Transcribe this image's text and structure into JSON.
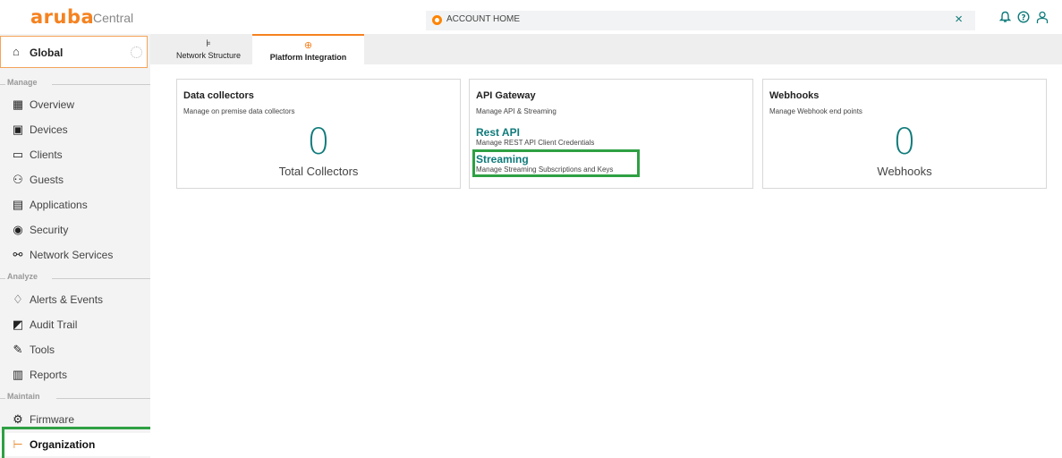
{
  "app": {
    "logo": "aruba",
    "product": "Central"
  },
  "search": {
    "text": "ACCOUNT HOME",
    "close": "×"
  },
  "header_icons": {
    "bell": "Δ",
    "help": "?",
    "user": "Ʌ"
  },
  "sidebar": {
    "global": {
      "label": "Global"
    },
    "sections": {
      "manage": "Manage",
      "analyze": "Analyze",
      "maintain": "Maintain"
    },
    "items": [
      {
        "label": "Overview",
        "icon": "▦"
      },
      {
        "label": "Devices",
        "icon": "▣"
      },
      {
        "label": "Clients",
        "icon": "▭"
      },
      {
        "label": "Guests",
        "icon": "⚇"
      },
      {
        "label": "Applications",
        "icon": "▤"
      },
      {
        "label": "Security",
        "icon": "◉"
      },
      {
        "label": "Network Services",
        "icon": "⚯"
      },
      {
        "label": "Alerts & Events",
        "icon": "♢"
      },
      {
        "label": "Audit Trail",
        "icon": "◩"
      },
      {
        "label": "Tools",
        "icon": "✎"
      },
      {
        "label": "Reports",
        "icon": "▥"
      },
      {
        "label": "Firmware",
        "icon": "⚙"
      },
      {
        "label": "Organization",
        "icon": "⊢"
      }
    ]
  },
  "tabs": [
    {
      "label": "Network Structure",
      "icon": "⊧"
    },
    {
      "label": "Platform Integration",
      "icon": "⊕"
    }
  ],
  "cards": {
    "collectors": {
      "title": "Data collectors",
      "subtitle": "Manage on premise data collectors",
      "count": "0",
      "count_label": "Total Collectors"
    },
    "api": {
      "title": "API Gateway",
      "subtitle": "Manage API & Streaming",
      "rest_link": "Rest API",
      "rest_desc": "Manage REST API Client Credentials",
      "stream_link": "Streaming",
      "stream_desc": "Manage Streaming Subscriptions and Keys"
    },
    "webhooks": {
      "title": "Webhooks",
      "subtitle": "Manage Webhook end points",
      "count": "0",
      "count_label": "Webhooks"
    }
  },
  "colors": {
    "brand_orange": "#f58220",
    "teal": "#0f7a7a",
    "highlight_green": "#2ea043"
  }
}
